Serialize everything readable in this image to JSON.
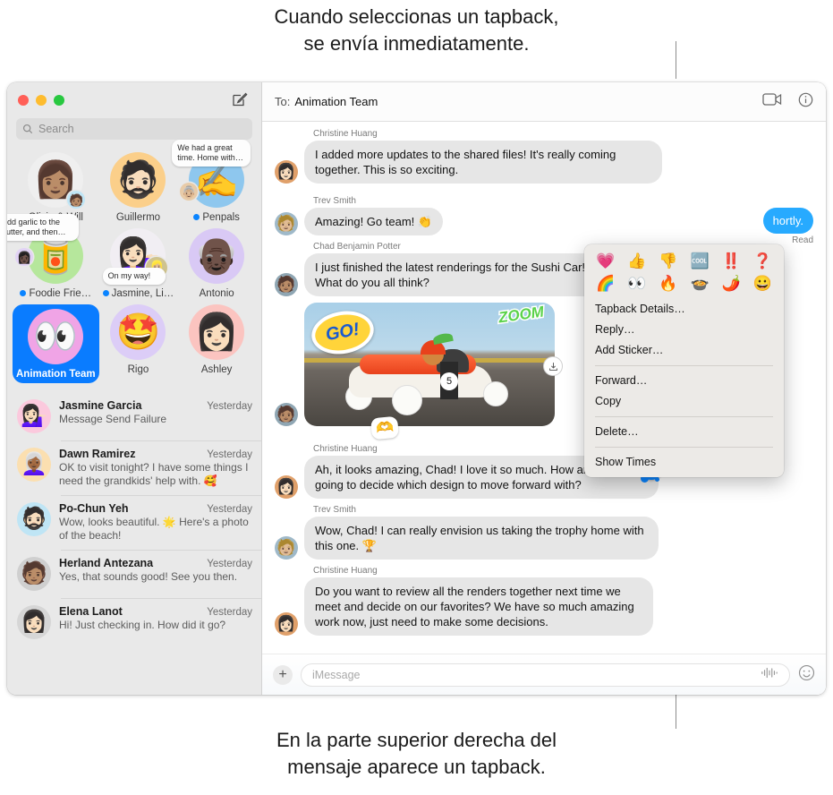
{
  "callouts": {
    "top": [
      "Cuando seleccionas un tapback,",
      "se envía inmediatamente."
    ],
    "bottom": [
      "En la parte superior derecha del",
      "mensaje aparece un tapback."
    ]
  },
  "colors": {
    "accent_blue": "#0a7cff",
    "bubble_gray": "#e6e6e6",
    "bubble_blue": "#27aaff",
    "sidebar_bg": "#e9e9e9",
    "menu_bg": "#eceae7"
  },
  "window": {
    "traffic_lights": [
      "close",
      "minimize",
      "zoom"
    ],
    "compose_label": "compose"
  },
  "sidebar": {
    "search": {
      "placeholder": "Search",
      "icon": "search-icon"
    },
    "pinned": [
      {
        "label": "Olivia & Will",
        "unread": false,
        "avatar": "👩🏽",
        "bg": "#efefef",
        "badge": "🧑🏽",
        "bubble": null
      },
      {
        "label": "Guillermo",
        "unread": false,
        "avatar": "🧔🏻",
        "bg": "#fbcf8a",
        "badge": null,
        "bubble": null
      },
      {
        "label": "Penpals",
        "unread": true,
        "avatar": "✍️",
        "bg": "#8ec7ee",
        "badge": "👵🏼",
        "bubble": "We had a great time. Home with…"
      },
      {
        "label": "Foodie Frie…",
        "unread": true,
        "avatar": "🥫",
        "bg": "#b6e79c",
        "badge": "👩🏿",
        "bubble": "Add garlic to the butter, and then…"
      },
      {
        "label": "Jasmine, Li…",
        "unread": true,
        "avatar": "💁🏻‍♀️",
        "bg": "#f1eef3",
        "badge": "👱🏼‍♀️",
        "bubble": "On my way!"
      },
      {
        "label": "Antonio",
        "unread": false,
        "avatar": "👴🏿",
        "bg": "#d9c9f5",
        "badge": null,
        "bubble": null
      },
      {
        "label": "Animation Team",
        "unread": false,
        "avatar": "👀",
        "bg": "#f0a4e6",
        "badge": null,
        "bubble": null,
        "selected": true
      },
      {
        "label": "Rigo",
        "unread": false,
        "avatar": "🤩",
        "bg": "#dccdf7",
        "badge": null,
        "bubble": null
      },
      {
        "label": "Ashley",
        "unread": false,
        "avatar": "👩🏻",
        "bg": "#fbc4c0",
        "badge": null,
        "bubble": null
      }
    ],
    "conversations": [
      {
        "name": "Jasmine Garcia",
        "time": "Yesterday",
        "preview": "Message Send Failure",
        "avatar": "💁🏻‍♀️",
        "avatar_bg": "#fbc9dd"
      },
      {
        "name": "Dawn Ramirez",
        "time": "Yesterday",
        "preview": "OK to visit tonight? I have some things I need the grandkids' help with. 🥰",
        "avatar": "👩🏾‍🦳",
        "avatar_bg": "#fbdfb0"
      },
      {
        "name": "Po-Chun Yeh",
        "time": "Yesterday",
        "preview": "Wow, looks beautiful. 🌟 Here's a photo of the beach!",
        "avatar": "🧔🏻",
        "avatar_bg": "#bfe5f5"
      },
      {
        "name": "Herland Antezana",
        "time": "Yesterday",
        "preview": "Yes, that sounds good! See you then.",
        "avatar": "🧑🏽",
        "avatar_bg": "#cfcfcf"
      },
      {
        "name": "Elena Lanot",
        "time": "Yesterday",
        "preview": "Hi! Just checking in. How did it go?",
        "avatar": "👩🏻",
        "avatar_bg": "#d6d6d6"
      }
    ]
  },
  "conversation": {
    "to_label": "To:",
    "to_value": "Animation Team",
    "header_icons": [
      "facetime-video-icon",
      "info-icon"
    ],
    "messages": [
      {
        "sender": "Christine Huang",
        "avatar": "👩🏻",
        "avatar_bg": "#e0a06a",
        "text": "I added more updates to the shared files! It's really coming together. This is so exciting."
      },
      {
        "sender": "Trev Smith",
        "avatar": "🧑🏼",
        "avatar_bg": "#9fb9c9",
        "text": "Amazing! Go team! 👏"
      },
      {
        "sender": "Chad Benjamin Potter",
        "avatar": "🧑🏽",
        "avatar_bg": "#8fa6b3",
        "text": "I just finished the latest renderings for the Sushi Car! What do you all think?"
      },
      {
        "sender": "Christine Huang",
        "avatar": "👩🏻",
        "avatar_bg": "#e0a06a",
        "text": "Ah, it looks amazing, Chad! I love it so much. How are we ever going to decide which design to move forward with?",
        "tapback": "🌈"
      },
      {
        "sender": "Trev Smith",
        "avatar": "🧑🏼",
        "avatar_bg": "#9fb9c9",
        "text": "Wow, Chad! I can really envision us taking the trophy home with this one. 🏆"
      },
      {
        "sender": "Christine Huang",
        "avatar": "👩🏻",
        "avatar_bg": "#e0a06a",
        "text": "Do you want to review all the renders together next time we meet and decide on our favorites? We have so much amazing work now, just need to make some decisions."
      }
    ],
    "photo_message": {
      "stickers": {
        "go": "GO!",
        "zoom": "ZOOM",
        "hands": "🫶"
      },
      "car_number": "5",
      "download_icon": "download-icon"
    },
    "outgoing_bubble": {
      "text": "hortly.",
      "status": "Read"
    },
    "input": {
      "placeholder": "iMessage",
      "plus": "+",
      "audio_icon": "audio-waveform-icon",
      "emoji_icon": "emoji-icon"
    }
  },
  "context_menu": {
    "tapbacks": [
      "💗",
      "👍",
      "👎",
      "🆒",
      "‼️",
      "❓",
      "🌈",
      "👀",
      "🔥",
      "🍲",
      "🌶️",
      "😀"
    ],
    "items": [
      {
        "label": "Tapback Details…",
        "sep_after": false
      },
      {
        "label": "Reply…",
        "sep_after": false
      },
      {
        "label": "Add Sticker…",
        "sep_after": true
      },
      {
        "label": "Forward…",
        "sep_after": false
      },
      {
        "label": "Copy",
        "sep_after": true
      },
      {
        "label": "Delete…",
        "sep_after": true
      },
      {
        "label": "Show Times",
        "sep_after": false
      }
    ]
  }
}
